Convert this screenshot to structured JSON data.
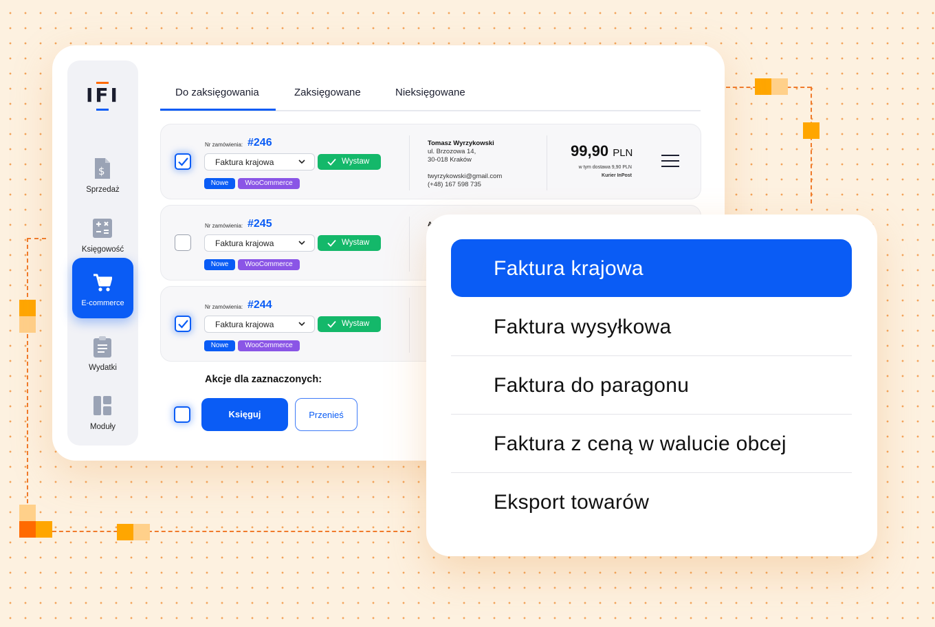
{
  "logo": "IFI",
  "sidebar": {
    "items": [
      {
        "label": "Sprzedaż",
        "icon": "invoice-dollar-icon"
      },
      {
        "label": "Księgowość",
        "icon": "calculator-icon"
      },
      {
        "label": "E-commerce",
        "icon": "cart-icon",
        "active": true
      },
      {
        "label": "Wydatki",
        "icon": "clipboard-icon"
      },
      {
        "label": "Moduły",
        "icon": "modules-icon"
      }
    ]
  },
  "tabs": [
    {
      "label": "Do zaksięgowania",
      "active": true
    },
    {
      "label": "Zaksięgowane"
    },
    {
      "label": "Nieksięgowane"
    }
  ],
  "orders": [
    {
      "checked": true,
      "order_label": "Nr zamówienia:",
      "number": "#246",
      "invoice_type": "Faktura krajowa",
      "action": "Wystaw",
      "badges": [
        "Nowe",
        "WooCommerce"
      ],
      "customer": {
        "name": "Tomasz Wyrzykowski",
        "street": "ul. Brzozowa 14,",
        "city": "30-018 Kraków",
        "email": "twyrzykowski@gmail.com",
        "phone": "(+48) 167 598 735"
      },
      "price": "99,90",
      "currency": "PLN",
      "shipping_note": "w tym dostawa 9,90 PLN",
      "carrier": "Kurier InPost"
    },
    {
      "checked": false,
      "order_label": "Nr zamówienia:",
      "number": "#245",
      "invoice_type": "Faktura krajowa",
      "action": "Wystaw",
      "badges": [
        "Nowe",
        "WooCommerce"
      ],
      "customer_initial": "A"
    },
    {
      "checked": true,
      "order_label": "Nr zamówienia:",
      "number": "#244",
      "invoice_type": "Faktura krajowa",
      "action": "Wystaw",
      "badges": [
        "Nowe",
        "WooCommerce"
      ]
    }
  ],
  "bulk": {
    "title": "Akcje dla zaznaczonych:",
    "primary": "Księguj",
    "secondary": "Przenieś"
  },
  "dropdown": {
    "selected": "Faktura krajowa",
    "options": [
      "Faktura krajowa",
      "Faktura wysyłkowa",
      "Faktura do paragonu",
      "Faktura z ceną w walucie obcej",
      "Eksport towarów"
    ]
  },
  "colors": {
    "accent": "#0a5cf5",
    "success": "#14b86a",
    "badge_purple": "#8a55e6",
    "decor_orange": "#ffa600",
    "decor_dash": "#f07a2b",
    "background": "#fdf1e0"
  }
}
